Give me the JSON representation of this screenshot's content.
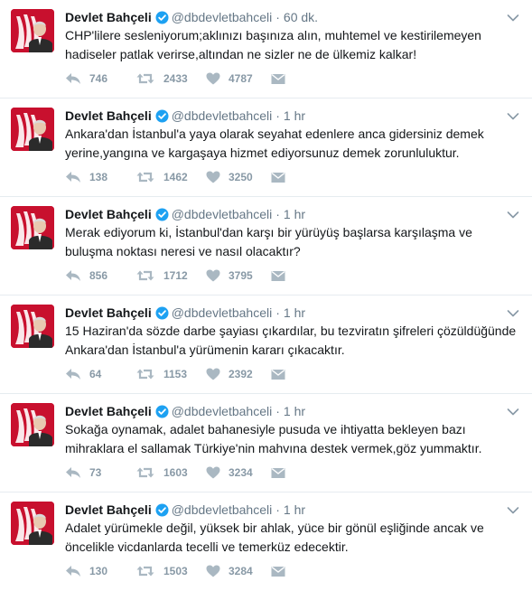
{
  "icons": {
    "reply": "reply-icon",
    "retweet": "retweet-icon",
    "like": "heart-icon",
    "dm": "envelope-icon",
    "verified": "verified-badge-icon",
    "caret": "chevron-down-icon"
  },
  "colors": {
    "name": "#14171a",
    "meta": "#657786",
    "verified": "#1da1f2",
    "action": "#aab8c2",
    "divider": "#e6ecf0",
    "avatar_bg": "#c8102e"
  },
  "tweets": [
    {
      "name": "Devlet Bahçeli",
      "handle": "@dbdevletbahceli",
      "dot": "·",
      "time": "60 dk.",
      "text": "CHP'lilere sesleniyorum;aklınızı başınıza alın, muhtemel ve kestirilemeyen hadiseler patlak verirse,altından ne sizler ne de ülkemiz kalkar!",
      "replies": "746",
      "retweets": "2433",
      "likes": "4787"
    },
    {
      "name": "Devlet Bahçeli",
      "handle": "@dbdevletbahceli",
      "dot": "·",
      "time": "1 hr",
      "text": "Ankara'dan İstanbul'a yaya olarak seyahat edenlere anca gidersiniz demek yerine,yangına ve kargaşaya hizmet ediyorsunuz demek zorunluluktur.",
      "replies": "138",
      "retweets": "1462",
      "likes": "3250"
    },
    {
      "name": "Devlet Bahçeli",
      "handle": "@dbdevletbahceli",
      "dot": "·",
      "time": "1 hr",
      "text": "Merak ediyorum ki, İstanbul'dan karşı bir yürüyüş başlarsa karşılaşma ve buluşma noktası neresi ve nasıl olacaktır?",
      "replies": "856",
      "retweets": "1712",
      "likes": "3795"
    },
    {
      "name": "Devlet Bahçeli",
      "handle": "@dbdevletbahceli",
      "dot": "·",
      "time": "1 hr",
      "text": "15 Haziran'da sözde darbe şayiası çıkardılar, bu tezviratın şifreleri çözüldüğünde Ankara'dan İstanbul'a yürümenin kararı çıkacaktır.",
      "replies": "64",
      "retweets": "1153",
      "likes": "2392"
    },
    {
      "name": "Devlet Bahçeli",
      "handle": "@dbdevletbahceli",
      "dot": "·",
      "time": "1 hr",
      "text": "Sokağa oynamak, adalet bahanesiyle pusuda ve ihtiyatta bekleyen bazı mihraklara el sallamak Türkiye'nin mahvına destek vermek,göz yummaktır.",
      "replies": "73",
      "retweets": "1603",
      "likes": "3234"
    },
    {
      "name": "Devlet Bahçeli",
      "handle": "@dbdevletbahceli",
      "dot": "·",
      "time": "1 hr",
      "text": "Adalet yürümekle değil, yüksek bir ahlak, yüce bir gönül eşliğinde ancak ve öncelikle vicdanlarda tecelli ve temerküz edecektir.",
      "replies": "130",
      "retweets": "1503",
      "likes": "3284"
    }
  ]
}
